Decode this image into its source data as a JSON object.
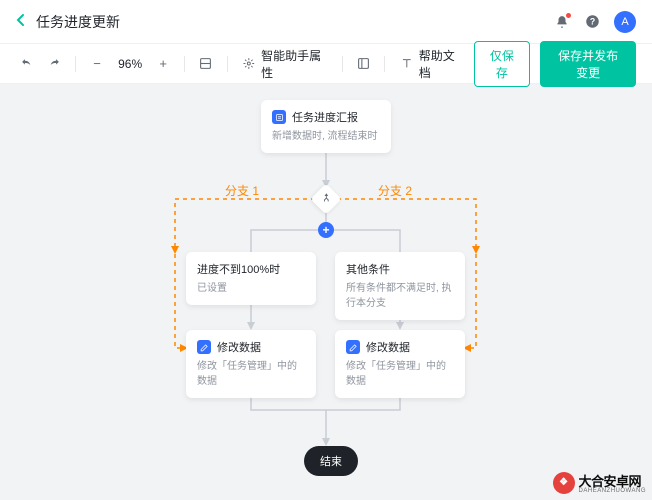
{
  "header": {
    "title": "任务进度更新",
    "avatar": "A"
  },
  "toolbar": {
    "zoom": "96%",
    "assistant": "智能助手属性",
    "help": "帮助文档",
    "save": "仅保存",
    "publish": "保存并发布变更"
  },
  "flow": {
    "start": {
      "title": "任务进度汇报",
      "sub": "新增数据时, 流程结束时"
    },
    "branch1_label": "分支 1",
    "branch2_label": "分支 2",
    "cond1": {
      "title": "进度不到100%时",
      "sub": "已设置"
    },
    "cond2": {
      "title": "其他条件",
      "sub": "所有条件都不满足时, 执行本分支"
    },
    "action1": {
      "title": "修改数据",
      "sub": "修改「任务管理」中的数据"
    },
    "action2": {
      "title": "修改数据",
      "sub": "修改「任务管理」中的数据"
    },
    "end": "结束"
  },
  "watermark": {
    "text": "大合安卓网",
    "sub": "DAHEANZHUOWANG"
  }
}
